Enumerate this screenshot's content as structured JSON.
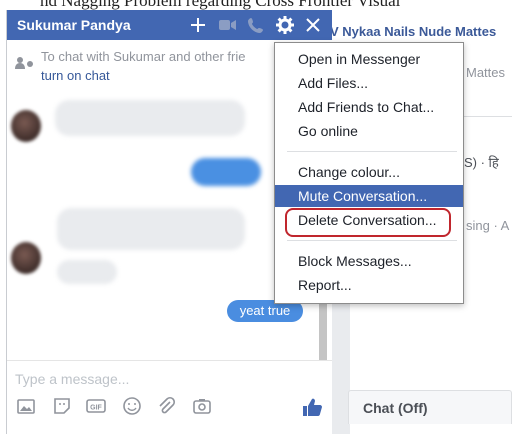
{
  "background_page": {
    "top_fragment": "nd Nagging Problem regarding Cross Frontier Visual",
    "title_link": "V Nykaa Nails Nude Mattes",
    "line2": "Mattes",
    "line3": "S) · हि",
    "line4": "sing · A",
    "chat_off": "Chat (Off)"
  },
  "chat": {
    "name": "Sukumar Pandya",
    "header_icons": [
      "plus-icon",
      "video-icon",
      "phone-icon",
      "gear-icon",
      "close-icon"
    ],
    "notice_text": "To chat with Sukumar and other frie",
    "notice_link": "turn on chat",
    "last_message": "yeat true",
    "composer_placeholder": "Type a message...",
    "composer_icons": [
      "photo-icon",
      "sticker-icon",
      "gif-icon",
      "emoji-icon",
      "attach-icon",
      "camera-icon",
      "like-icon"
    ]
  },
  "menu": {
    "items": [
      "Open in Messenger",
      "Add Files...",
      "Add Friends to Chat...",
      "Go online",
      "Change colour...",
      "Mute Conversation...",
      "Delete Conversation...",
      "Block Messages...",
      "Report..."
    ],
    "highlighted_index": 5,
    "circled_index": 6,
    "highlight_color": "#4267b2",
    "circle_color": "#c0262d"
  },
  "colors": {
    "header": "#4267b2",
    "link": "#365899",
    "bubble_out": "#4a8de0"
  }
}
